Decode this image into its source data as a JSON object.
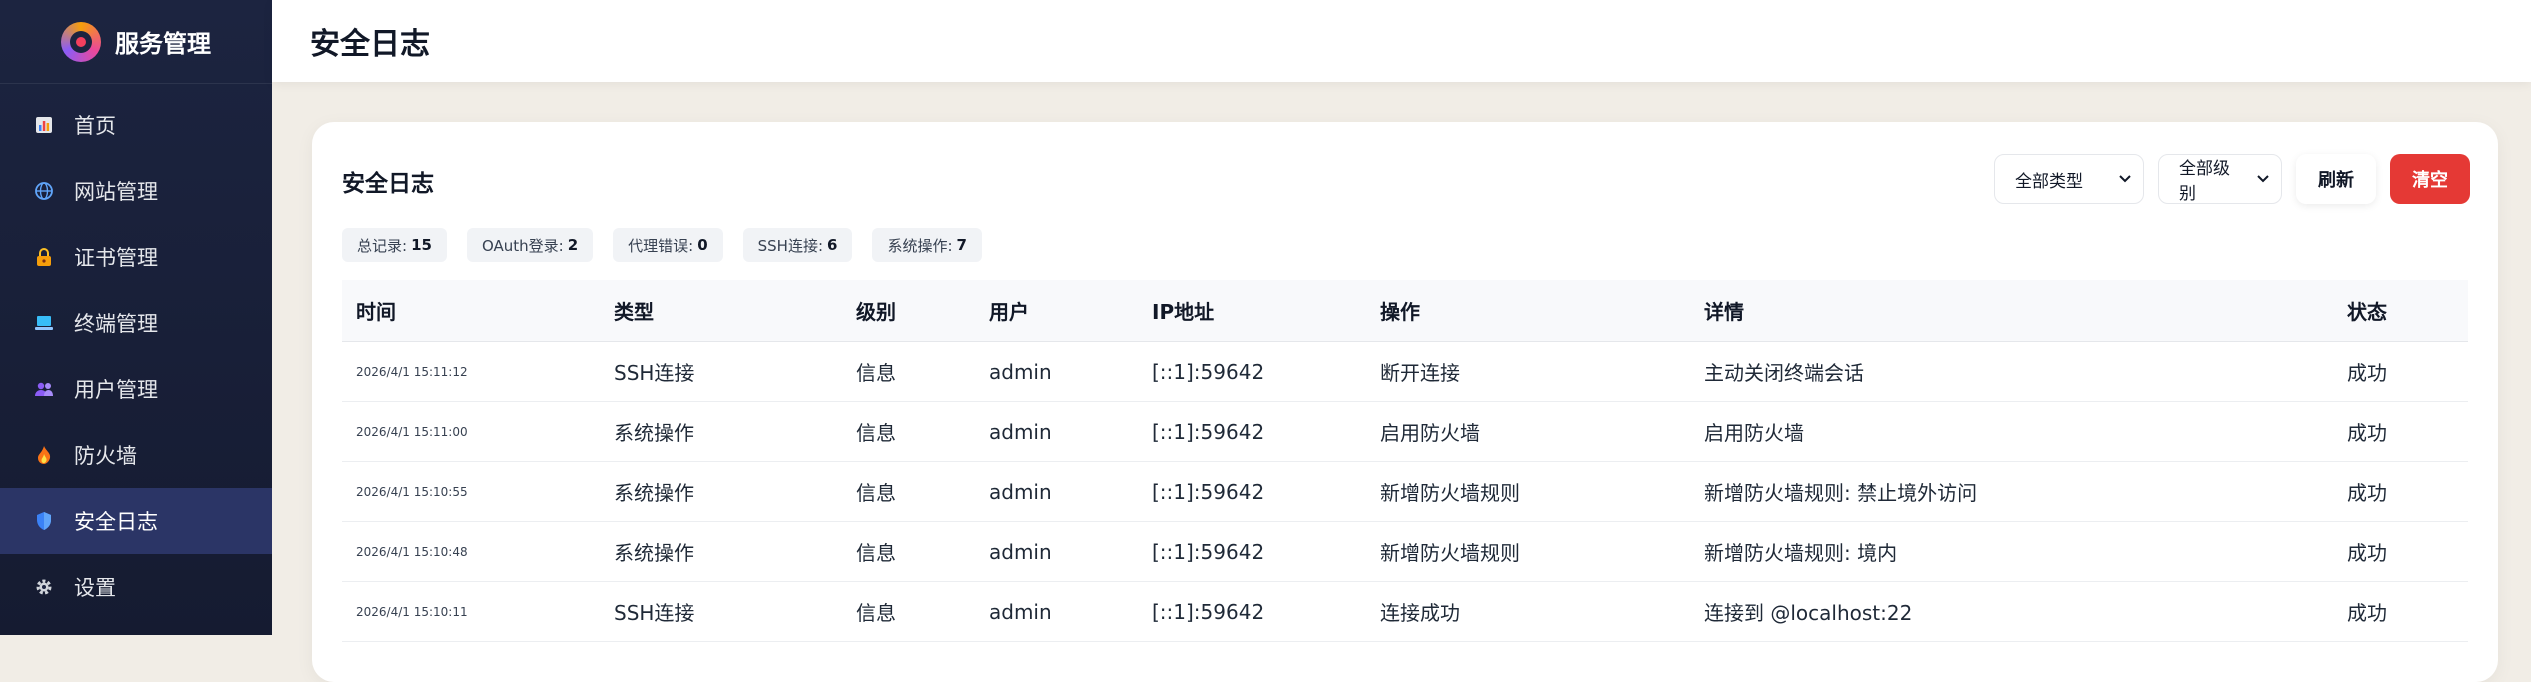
{
  "app": {
    "name": "服务管理"
  },
  "sidebar": {
    "items": [
      {
        "label": "首页",
        "icon": "bar-chart-icon"
      },
      {
        "label": "网站管理",
        "icon": "globe-icon"
      },
      {
        "label": "证书管理",
        "icon": "lock-icon"
      },
      {
        "label": "终端管理",
        "icon": "laptop-icon"
      },
      {
        "label": "用户管理",
        "icon": "users-icon"
      },
      {
        "label": "防火墙",
        "icon": "fire-icon"
      },
      {
        "label": "安全日志",
        "icon": "shield-icon",
        "active": true
      },
      {
        "label": "设置",
        "icon": "gear-icon"
      }
    ]
  },
  "header": {
    "title": "安全日志"
  },
  "card": {
    "title": "安全日志",
    "type_select": "全部类型",
    "level_select": "全部级别",
    "refresh_label": "刷新",
    "clear_label": "清空"
  },
  "stats": [
    {
      "label": "总记录:",
      "value": "15"
    },
    {
      "label": "OAuth登录:",
      "value": "2"
    },
    {
      "label": "代理错误:",
      "value": "0"
    },
    {
      "label": "SSH连接:",
      "value": "6"
    },
    {
      "label": "系统操作:",
      "value": "7"
    }
  ],
  "table": {
    "headers": [
      "时间",
      "类型",
      "级别",
      "用户",
      "IP地址",
      "操作",
      "详情",
      "状态"
    ],
    "rows": [
      [
        "2026/4/1 15:11:12",
        "SSH连接",
        "信息",
        "admin",
        "[::1]:59642",
        "断开连接",
        "主动关闭终端会话",
        "成功"
      ],
      [
        "2026/4/1 15:11:00",
        "系统操作",
        "信息",
        "admin",
        "[::1]:59642",
        "启用防火墙",
        "启用防火墙",
        "成功"
      ],
      [
        "2026/4/1 15:10:55",
        "系统操作",
        "信息",
        "admin",
        "[::1]:59642",
        "新增防火墙规则",
        "新增防火墙规则: 禁止境外访问",
        "成功"
      ],
      [
        "2026/4/1 15:10:48",
        "系统操作",
        "信息",
        "admin",
        "[::1]:59642",
        "新增防火墙规则",
        "新增防火墙规则: 境内",
        "成功"
      ],
      [
        "2026/4/1 15:10:11",
        "SSH连接",
        "信息",
        "admin",
        "[::1]:59642",
        "连接成功",
        "连接到 @localhost:22",
        "成功"
      ]
    ]
  },
  "colors": {
    "sidebar_bg": "#1c2440",
    "active_item": "#2b3566",
    "danger": "#e53935"
  }
}
